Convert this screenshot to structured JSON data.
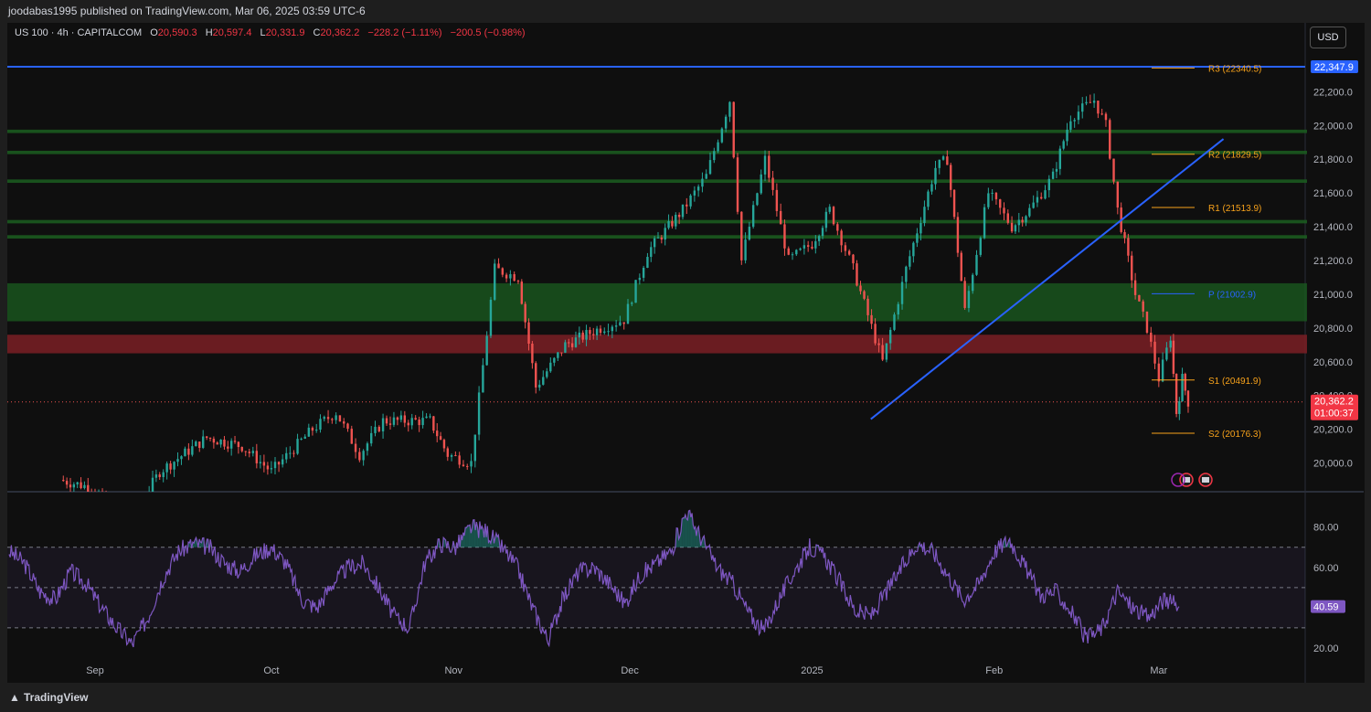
{
  "header": {
    "published": "joodabas1995 published on TradingView.com, Mar 06, 2025 03:59 UTC-6"
  },
  "legend": {
    "symbol": "US 100 · 4h · CAPITALCOM",
    "o_label": "O",
    "o": "20,590.3",
    "h_label": "H",
    "h": "20,597.4",
    "l_label": "L",
    "l": "20,331.9",
    "c_label": "C",
    "c": "20,362.2",
    "change": "−228.2 (−1.11%)",
    "change2": "−200.5 (−0.98%)"
  },
  "currency": "USD",
  "footer": {
    "brand": "TradingView"
  },
  "colors": {
    "up": "#26a69a",
    "down": "#ef5350",
    "rsi": "#7e57c2",
    "trend": "#2962ff",
    "pivot_res": "#f7a21b",
    "pivot_p": "#2962ff",
    "zone_green": "#1b5e20",
    "zone_red": "#7a1f24"
  },
  "chart_data": [
    {
      "type": "candlestick",
      "title": "US 100 · 4h · CAPITALCOM",
      "yticks": [
        "22,200.0",
        "22,000.0",
        "21,800.0",
        "21,600.0",
        "21,400.0",
        "21,200.0",
        "21,000.0",
        "20,800.0",
        "20,600.0",
        "20,400.0",
        "20,200.0",
        "20,000.0"
      ],
      "ylim": [
        19830,
        22440
      ],
      "xticks": [
        "Sep",
        "Oct",
        "Nov",
        "Dec",
        "2025",
        "Feb",
        "Mar"
      ],
      "last_price": "20,362.2",
      "countdown": "01:00:37",
      "top_price_label": "22,347.9",
      "close_path": [
        [
          "Aug 26",
          19900
        ],
        [
          "Sep 01",
          19850
        ],
        [
          "Sep 06",
          19600
        ],
        [
          "Sep 12",
          19950
        ],
        [
          "Sep 20",
          20150
        ],
        [
          "Sep 26",
          20100
        ],
        [
          "Oct 01",
          19950
        ],
        [
          "Oct 08",
          20200
        ],
        [
          "Oct 12",
          20300
        ],
        [
          "Oct 16",
          20050
        ],
        [
          "Oct 20",
          20250
        ],
        [
          "Oct 28",
          20250
        ],
        [
          "Oct 31",
          20050
        ],
        [
          "Nov 04",
          20000
        ],
        [
          "Nov 08",
          21150
        ],
        [
          "Nov 12",
          21100
        ],
        [
          "Nov 15",
          20450
        ],
        [
          "Nov 20",
          20700
        ],
        [
          "Nov 26",
          20800
        ],
        [
          "Nov 30",
          20850
        ],
        [
          "Dec 04",
          21250
        ],
        [
          "Dec 10",
          21500
        ],
        [
          "Dec 14",
          21700
        ],
        [
          "Dec 18",
          22150
        ],
        [
          "Dec 20",
          21200
        ],
        [
          "Dec 24",
          21800
        ],
        [
          "Dec 28",
          21200
        ],
        [
          "Jan 01",
          21300
        ],
        [
          "Jan 04",
          21500
        ],
        [
          "Jan 08",
          21150
        ],
        [
          "Jan 13",
          20600
        ],
        [
          "Jan 17",
          21150
        ],
        [
          "Jan 22",
          21750
        ],
        [
          "Jan 24",
          21800
        ],
        [
          "Jan 27",
          20900
        ],
        [
          "Jan 31",
          21600
        ],
        [
          "Feb 04",
          21400
        ],
        [
          "Feb 07",
          21500
        ],
        [
          "Feb 11",
          21700
        ],
        [
          "Feb 14",
          22050
        ],
        [
          "Feb 18",
          22150
        ],
        [
          "Feb 20",
          22000
        ],
        [
          "Feb 22",
          21500
        ],
        [
          "Feb 25",
          21000
        ],
        [
          "Feb 27",
          20800
        ],
        [
          "Mar 01",
          20500
        ],
        [
          "Mar 03",
          20750
        ],
        [
          "Mar 04",
          20300
        ],
        [
          "Mar 05",
          20500
        ],
        [
          "Mar 06",
          20362.2
        ]
      ],
      "zones": [
        {
          "kind": "resistance",
          "from": 21975,
          "to": 21955
        },
        {
          "kind": "resistance",
          "from": 21850,
          "to": 21830
        },
        {
          "kind": "resistance",
          "from": 21680,
          "to": 21660
        },
        {
          "kind": "resistance",
          "from": 21440,
          "to": 21420
        },
        {
          "kind": "resistance",
          "from": 21350,
          "to": 21330
        },
        {
          "kind": "support",
          "from": 21065,
          "to": 20840
        },
        {
          "kind": "demand",
          "from": 20760,
          "to": 20650
        }
      ],
      "pivots": [
        {
          "label": "R3 (22340.5)",
          "value": 22340.5
        },
        {
          "label": "R2 (21829.5)",
          "value": 21829.5
        },
        {
          "label": "R1 (21513.9)",
          "value": 21513.9
        },
        {
          "label": "P (21002.9)",
          "value": 21002.9
        },
        {
          "label": "S1 (20491.9)",
          "value": 20491.9
        },
        {
          "label": "S2 (20176.3)",
          "value": 20176.3
        }
      ],
      "trendline": {
        "from": [
          "Jan 11",
          20260
        ],
        "to": [
          "Mar 12",
          21920
        ]
      },
      "resistance_line": 22347.9
    },
    {
      "type": "line",
      "title": "RSI",
      "yticks": [
        "80.00",
        "60.00",
        "40.00",
        "20.00"
      ],
      "ylim": [
        15,
        93
      ],
      "bands": [
        70,
        50,
        30
      ],
      "last_value": "40.59",
      "values": [
        68,
        62,
        48,
        44,
        58,
        52,
        40,
        30,
        22,
        35,
        55,
        68,
        72,
        70,
        62,
        58,
        66,
        70,
        62,
        44,
        40,
        52,
        60,
        62,
        50,
        36,
        30,
        62,
        72,
        70,
        80,
        78,
        70,
        60,
        40,
        24,
        45,
        58,
        60,
        52,
        42,
        56,
        62,
        68,
        88,
        74,
        60,
        52,
        38,
        28,
        44,
        58,
        70,
        65,
        52,
        38,
        36,
        48,
        60,
        72,
        68,
        56,
        44,
        52,
        68,
        74,
        60,
        46,
        48,
        38,
        24,
        30,
        48,
        40,
        35,
        44,
        40.59
      ]
    }
  ]
}
